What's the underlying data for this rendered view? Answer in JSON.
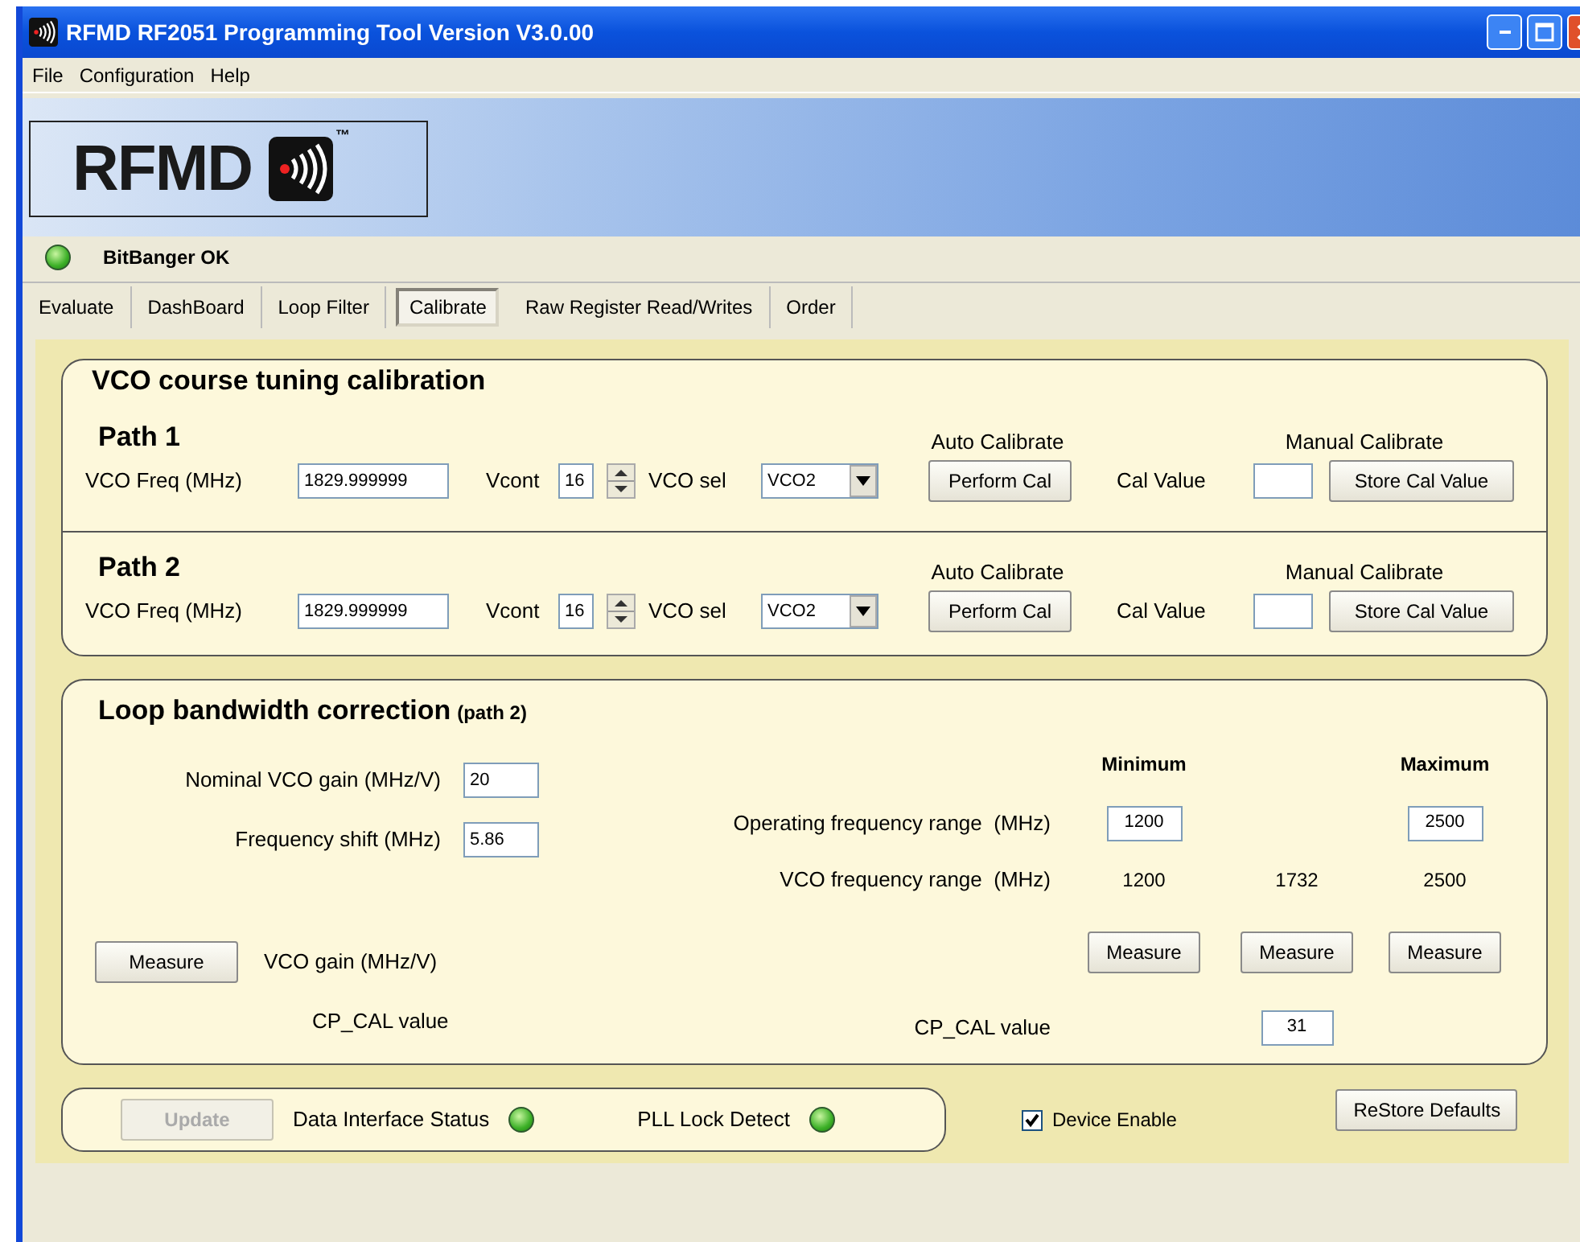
{
  "window": {
    "title": "RFMD RF2051 Programming Tool Version V3.0.00"
  },
  "menu": [
    "File",
    "Configuration",
    "Help"
  ],
  "logo": {
    "text": "RFMD",
    "trademark": "™"
  },
  "connection": {
    "label": "BitBanger OK",
    "on": true
  },
  "tabs": [
    {
      "label": "Evaluate",
      "selected": false
    },
    {
      "label": "DashBoard",
      "selected": false
    },
    {
      "label": "Loop Filter",
      "selected": false
    },
    {
      "label": "Calibrate",
      "selected": true
    },
    {
      "label": "Raw Register Read/Writes",
      "selected": false
    },
    {
      "label": "Order",
      "selected": false
    }
  ],
  "vco_calibration": {
    "title": "VCO course tuning calibration",
    "paths": [
      {
        "title": "Path 1",
        "auto_label": "Auto Calibrate",
        "manual_label": "Manual Calibrate",
        "freq_label": "VCO Freq (MHz)",
        "freq_value": "1829.999999",
        "vcont_label": "Vcont",
        "vcont_value": "16",
        "vco_sel_label": "VCO sel",
        "vco_sel_value": "VCO2",
        "perform_button": "Perform Cal",
        "cal_value_label": "Cal Value",
        "store_button": "Store Cal Value"
      },
      {
        "title": "Path 2",
        "auto_label": "Auto Calibrate",
        "manual_label": "Manual Calibrate",
        "freq_label": "VCO Freq (MHz)",
        "freq_value": "1829.999999",
        "vcont_label": "Vcont",
        "vcont_value": "16",
        "vco_sel_label": "VCO sel",
        "vco_sel_value": "VCO2",
        "perform_button": "Perform Cal",
        "cal_value_label": "Cal Value",
        "store_button": "Store Cal Value"
      }
    ]
  },
  "loop_bandwidth": {
    "title": "Loop bandwidth correction",
    "note": "(path 2)",
    "nominal_gain": {
      "label": "Nominal VCO gain (MHz/V)",
      "value": "20"
    },
    "frequency_shift": {
      "label": "Frequency shift (MHz)",
      "value": "5.86"
    },
    "measure_button": "Measure",
    "vco_gain_label": "VCO gain (MHz/V)",
    "cp_cal_label": "CP_CAL value",
    "range_headers": [
      "Minimum",
      "Maximum"
    ],
    "operating_range": {
      "label": "Operating frequency range  (MHz)",
      "min": "1200",
      "max": "2500"
    },
    "vco_range": {
      "label": "VCO frequency range  (MHz)",
      "values": [
        "1200",
        "1732",
        "2500"
      ]
    },
    "measure_buttons": [
      "Measure",
      "Measure",
      "Measure"
    ],
    "cp_cal": {
      "label": "CP_CAL value",
      "value": "31"
    }
  },
  "status": {
    "update_button": {
      "label": "Update",
      "disabled": true
    },
    "indicators": [
      {
        "label": "Data Interface Status",
        "on": true
      },
      {
        "label": "PLL Lock Detect",
        "on": true
      }
    ],
    "device_enable": {
      "label": "Device Enable",
      "checked": true
    },
    "restore_button": "ReStore Defaults"
  }
}
